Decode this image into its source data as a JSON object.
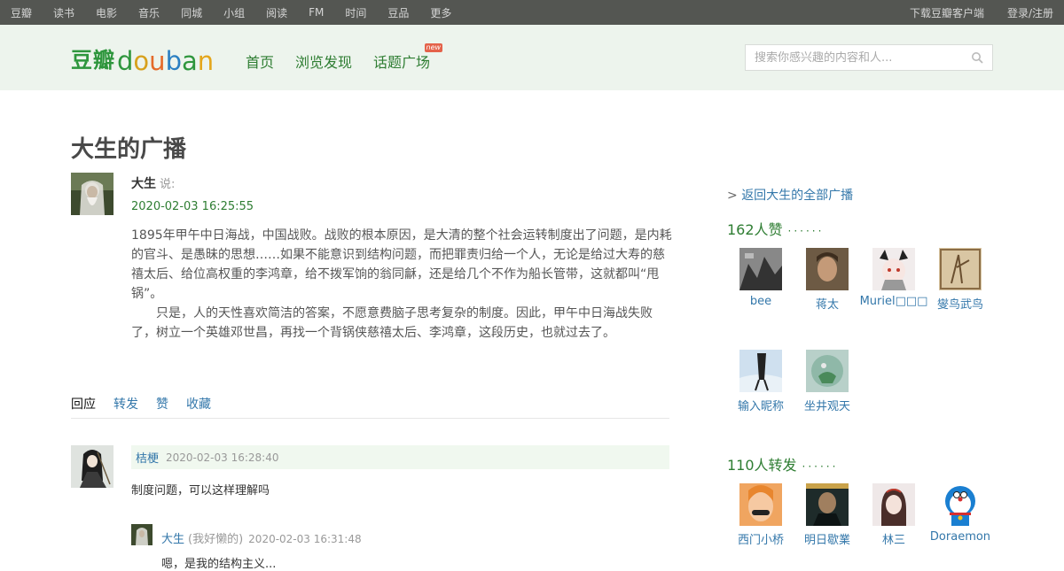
{
  "topbar": {
    "left": [
      "豆瓣",
      "读书",
      "电影",
      "音乐",
      "同城",
      "小组",
      "阅读",
      "FM",
      "时间",
      "豆品",
      "更多"
    ],
    "download": "下载豆瓣客户端",
    "login": "登录/注册"
  },
  "header": {
    "logo_cn": "豆瓣",
    "logo_en": "douban",
    "nav": [
      "首页",
      "浏览发现",
      "话题广场"
    ],
    "new_badge": "new",
    "search_placeholder": "搜索你感兴趣的内容和人..."
  },
  "page": {
    "title": "大生的广播"
  },
  "status": {
    "author": "大生",
    "said": "说:",
    "time": "2020-02-03 16:25:55",
    "para1": "1895年甲午中日海战，中国战败。战败的根本原因，是大清的整个社会运转制度出了问题，是内耗的官斗、是愚昧的思想……如果不能意识到结构问题，而把罪责归给一个人，无论是给过大寿的慈禧太后、给位高权重的李鸿章，给不拨军饷的翁同龢，还是给几个不作为船长管带，这就都叫“甩锅”。",
    "para2": "只是，人的天性喜欢简洁的答案，不愿意费脑子思考复杂的制度。因此，甲午中日海战失败了，树立一个英雄邓世昌，再找一个背锅侠慈禧太后、李鸿章，这段历史，也就过去了。"
  },
  "tabs": [
    "回应",
    "转发",
    "赞",
    "收藏"
  ],
  "comment": {
    "who": "桔梗",
    "time": "2020-02-03 16:28:40",
    "text": "制度问题，可以这样理解吗"
  },
  "reply": {
    "who": "大生",
    "note": "(我好懒的)",
    "time": "2020-02-03 16:31:48",
    "text": "嗯，是我的结构主义..."
  },
  "aside": {
    "back": "返回大生的全部广播",
    "back_prefix": ">",
    "likes_title": "162人赞",
    "likes_dots": "······",
    "likes": [
      "bee",
      "蒋太",
      "Muriel□□□",
      "燮鸟武鸟",
      "输入昵称",
      "坐井观天"
    ],
    "shares_title": "110人转发",
    "shares_dots": "······",
    "shares": [
      "西门小桥",
      "明日歇業",
      "林三",
      "Doraemon"
    ]
  }
}
